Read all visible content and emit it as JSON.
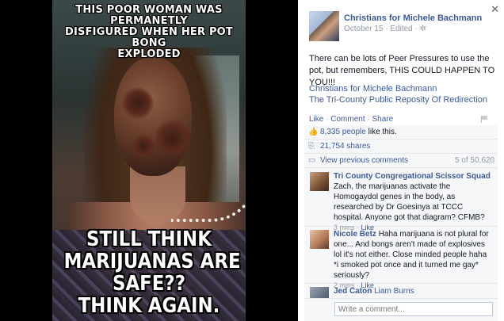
{
  "meme": {
    "top_text": [
      "THIS POOR WOMAN WAS PERMANETLY",
      "DISFIGURED WHEN HER POT BONG",
      "EXPLODED"
    ],
    "bottom_text": [
      "STILL THINK",
      "MARIJUANAS ARE",
      "SAFE??",
      "THINK AGAIN."
    ]
  },
  "post": {
    "page_name": "Christians for Michele Bachmann",
    "date": "October 15",
    "edited": "Edited",
    "body": "There can be lots of Peer Pressures to use the pot, but remembers, THIS COULD HAPPEN TO YOU!!!",
    "link1": "Christians for Michele Bachmann",
    "link2": "The Tri-County Public Reposity Of Redirection"
  },
  "actions": {
    "like": "Like",
    "comment": "Comment",
    "share": "Share"
  },
  "ufi": {
    "likes_count": "8,335 people",
    "likes_suffix": "like this.",
    "shares": "21,754 shares",
    "view_previous": "View previous comments",
    "comment_count": "5 of 50,620"
  },
  "comments": [
    {
      "name": "Tri County Congregational Scissor Squad",
      "text": "Zach, the marijuanas activate the Homogaydol genes in the body, as researched by Dr Goesinya at TCCC hospital. Anyone got that diagram? CFMB?",
      "time": "3 mins",
      "like": "Like"
    },
    {
      "name": "Nicole Betz",
      "text": "Haha marijuana is not plural for one... And bongs aren't made of explosives lol it's not either. Close minded people haha *i smoked pot once and it turned me gay* seriously?",
      "time": "2 mins",
      "like": "Like"
    },
    {
      "name": "Jed Caton",
      "text": "Liam Burns",
      "time": "",
      "like": ""
    }
  ],
  "write_placeholder": "Write a comment..."
}
